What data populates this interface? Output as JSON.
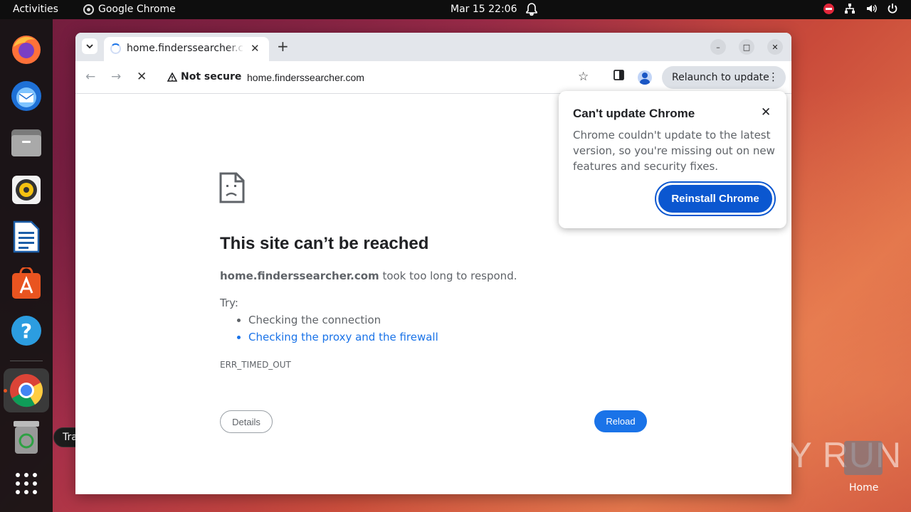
{
  "topbar": {
    "activities": "Activities",
    "app_name": "Google Chrome",
    "clock": "Mar 15  22:06"
  },
  "dock": {
    "tooltip": "Trash",
    "items": [
      "firefox",
      "thunderbird",
      "files",
      "rhythmbox",
      "libreoffice-writer",
      "app-center",
      "help",
      "google-chrome",
      "trash",
      "show-apps"
    ]
  },
  "browser": {
    "tab_title": "home.finderssearcher.com",
    "security_label": "Not secure",
    "url": "home.finderssearcher.com",
    "relaunch_label": "Relaunch to update"
  },
  "error_page": {
    "title": "This site can’t be reached",
    "host": "home.finderssearcher.com",
    "message": " took too long to respond.",
    "try_label": "Try:",
    "suggestions": [
      "Checking the connection",
      "Checking the proxy and the firewall"
    ],
    "error_code": "ERR_TIMED_OUT",
    "details_button": "Details",
    "reload_button": "Reload"
  },
  "update_popup": {
    "title": "Can't update Chrome",
    "body": "Chrome couldn't update to the latest version, so you're missing out on new features and security fixes.",
    "button": "Reinstall Chrome"
  },
  "desktop": {
    "watermark": "ANY RUN",
    "home_label": "Home"
  },
  "colors": {
    "accent": "#1a73e8",
    "popup_button": "#0b57d0",
    "ubuntu_orange": "#e95420"
  }
}
